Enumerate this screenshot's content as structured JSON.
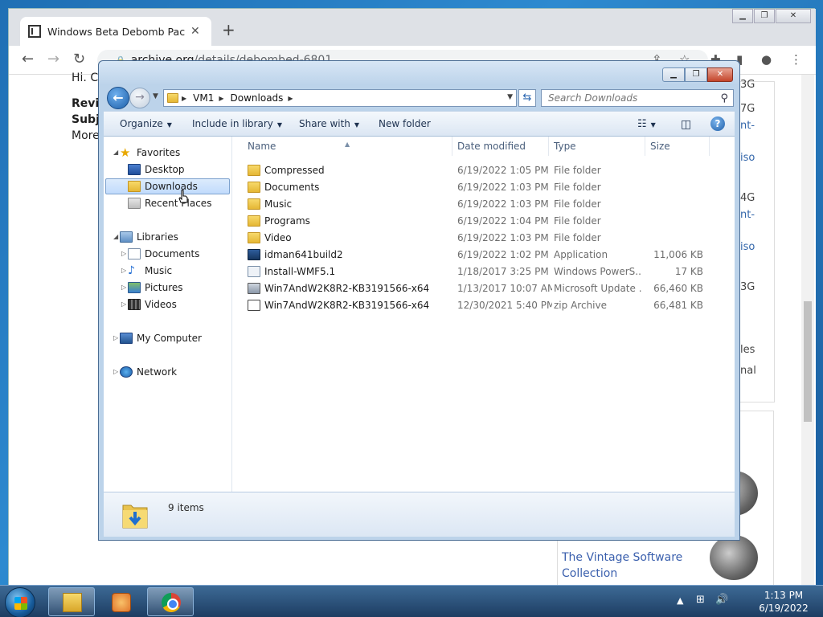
{
  "browser": {
    "tab_title": "Windows Beta Debomb Pack : W",
    "new_tab_glyph": "+",
    "url_host": "archive.org",
    "url_path": "/details/debombed-6801",
    "page_left": [
      "Hi. C",
      "Revie",
      "Subje",
      "More"
    ],
    "page_right": [
      "3G",
      "7G",
      "nt-",
      "iso",
      "4G",
      "nt-",
      "iso",
      "3G",
      "les",
      "nal"
    ],
    "collection_link": "The Vintage Software Collection"
  },
  "explorer": {
    "breadcrumb": [
      "VM1",
      "Downloads"
    ],
    "search_placeholder": "Search Downloads",
    "toolbar": {
      "organize": "Organize",
      "include_in_library": "Include in library",
      "share_with": "Share with",
      "new_folder": "New folder"
    },
    "nav": {
      "favorites": "Favorites",
      "desktop": "Desktop",
      "downloads": "Downloads",
      "recent_places": "Recent Places",
      "libraries": "Libraries",
      "documents": "Documents",
      "music": "Music",
      "pictures": "Pictures",
      "videos": "Videos",
      "my_computer": "My Computer",
      "network": "Network"
    },
    "columns": {
      "name": "Name",
      "date": "Date modified",
      "type": "Type",
      "size": "Size"
    },
    "files": [
      {
        "name": "Compressed",
        "date": "6/19/2022 1:05 PM",
        "type": "File folder",
        "size": "",
        "icon": "folder-icon"
      },
      {
        "name": "Documents",
        "date": "6/19/2022 1:03 PM",
        "type": "File folder",
        "size": "",
        "icon": "folder-icon"
      },
      {
        "name": "Music",
        "date": "6/19/2022 1:03 PM",
        "type": "File folder",
        "size": "",
        "icon": "folder-icon"
      },
      {
        "name": "Programs",
        "date": "6/19/2022 1:04 PM",
        "type": "File folder",
        "size": "",
        "icon": "folder-icon"
      },
      {
        "name": "Video",
        "date": "6/19/2022 1:03 PM",
        "type": "File folder",
        "size": "",
        "icon": "folder-icon"
      },
      {
        "name": "idman641build2",
        "date": "6/19/2022 1:02 PM",
        "type": "Application",
        "size": "11,006 KB",
        "icon": "application-icon"
      },
      {
        "name": "Install-WMF5.1",
        "date": "1/18/2017 3:25 PM",
        "type": "Windows PowerS...",
        "size": "17 KB",
        "icon": "powershell-icon"
      },
      {
        "name": "Win7AndW2K8R2-KB3191566-x64",
        "date": "1/13/2017 10:07 AM",
        "type": "Microsoft Update ...",
        "size": "66,460 KB",
        "icon": "update-icon"
      },
      {
        "name": "Win7AndW2K8R2-KB3191566-x64",
        "date": "12/30/2021 5:40 PM",
        "type": "zip Archive",
        "size": "66,481 KB",
        "icon": "zip-icon"
      }
    ],
    "item_count": "9 items"
  },
  "taskbar": {
    "time": "1:13 PM",
    "date": "6/19/2022"
  }
}
